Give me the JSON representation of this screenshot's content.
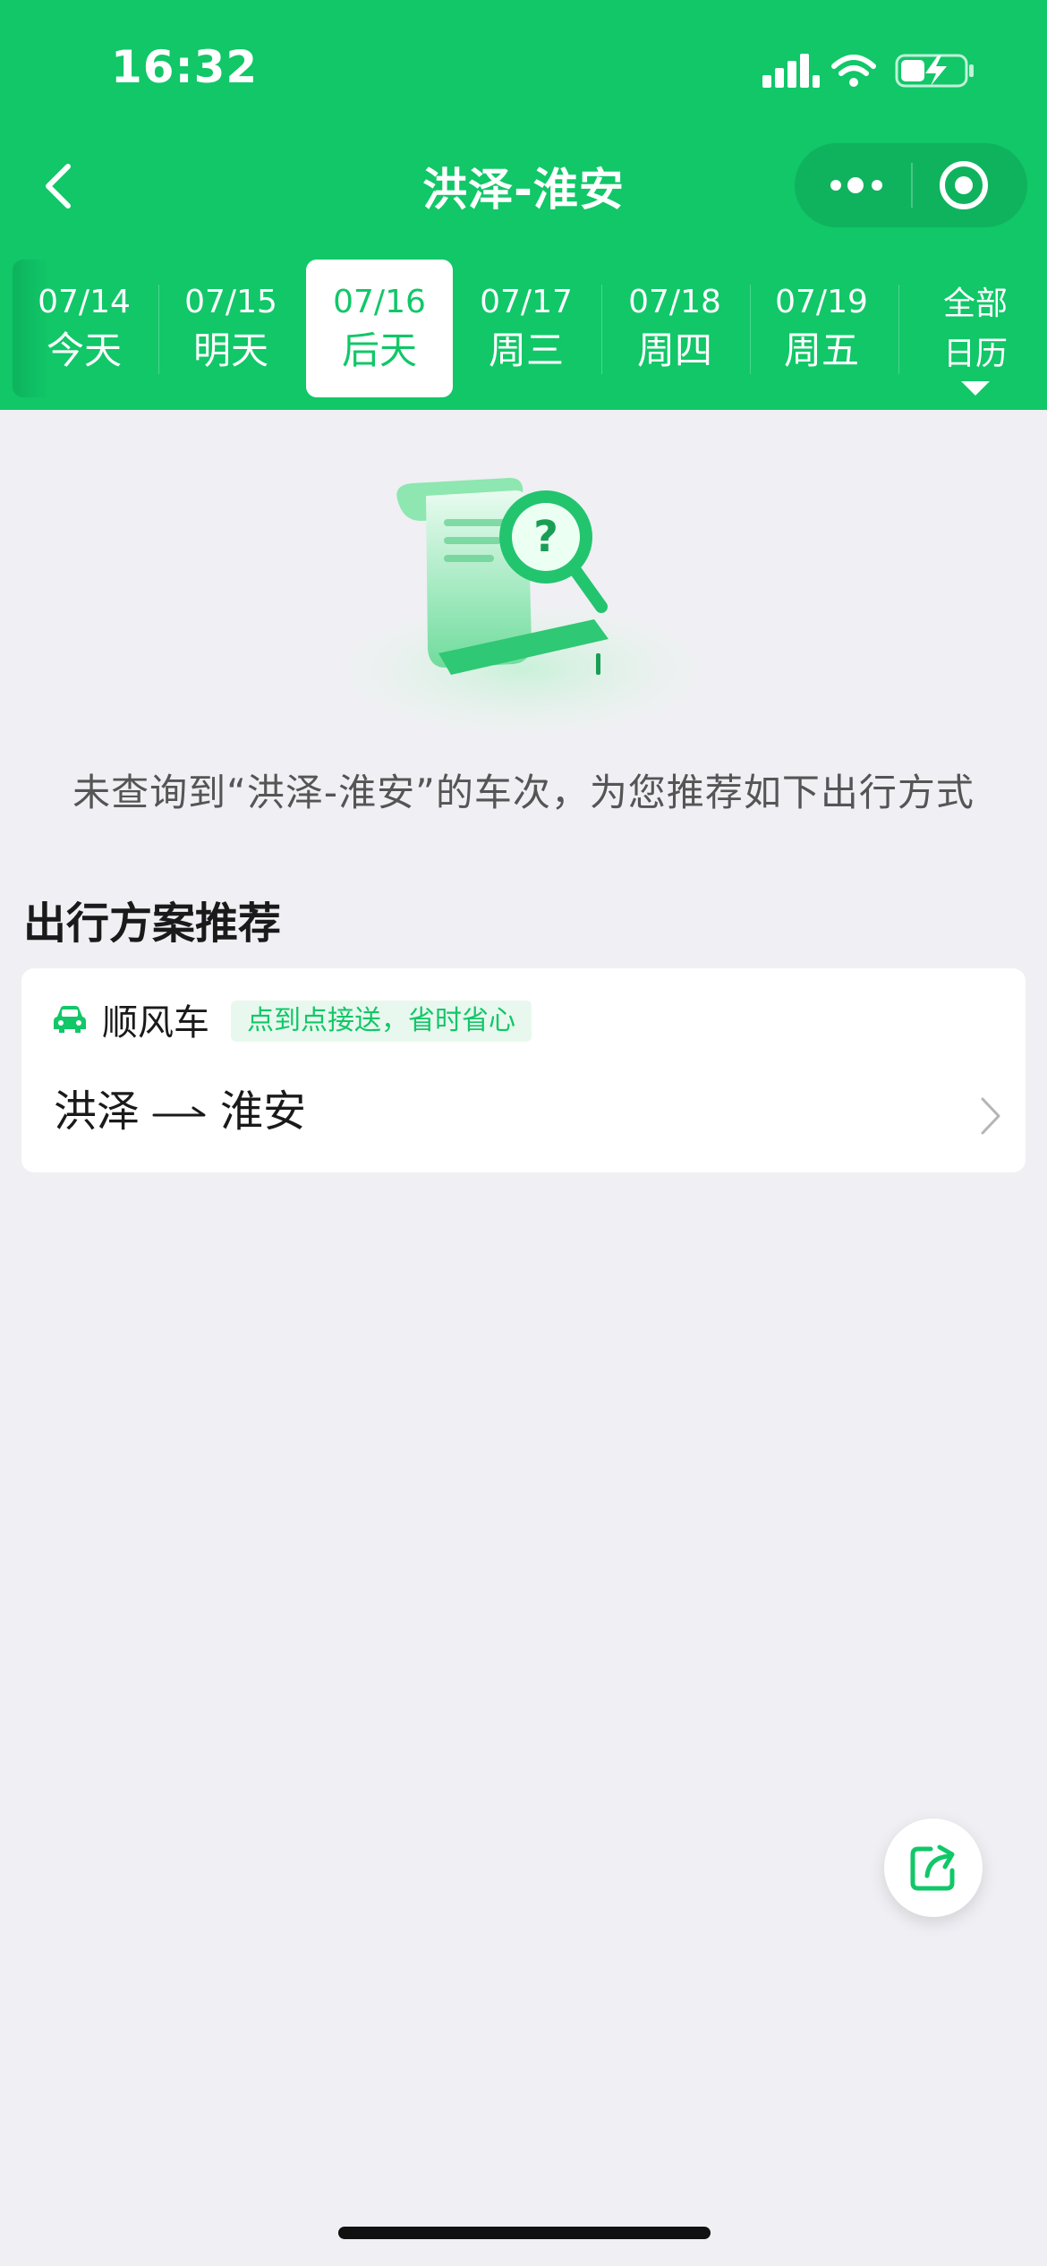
{
  "status_bar": {
    "time": "16:32"
  },
  "nav": {
    "title": "洪泽-淮安"
  },
  "dates": [
    {
      "date": "07/14",
      "day": "今天",
      "active": false
    },
    {
      "date": "07/15",
      "day": "明天",
      "active": false
    },
    {
      "date": "07/16",
      "day": "后天",
      "active": true
    },
    {
      "date": "07/17",
      "day": "周三",
      "active": false
    },
    {
      "date": "07/18",
      "day": "周四",
      "active": false
    },
    {
      "date": "07/19",
      "day": "周五",
      "active": false
    }
  ],
  "calendar": {
    "line1": "全部",
    "line2": "日历"
  },
  "empty_state": {
    "message": "未查询到“洪泽-淮安”的车次，为您推荐如下出行方式"
  },
  "recommend": {
    "section_title": "出行方案推荐",
    "card": {
      "type": "顺风车",
      "tag": "点到点接送，省时省心",
      "from": "洪泽",
      "to": "淮安"
    }
  },
  "colors": {
    "brand": "#11c768",
    "background": "#efeff4",
    "tag_bg": "#e8f8ee"
  },
  "icons": {
    "back": "chevron-left-icon",
    "more": "more-dots-icon",
    "close": "target-close-icon",
    "car": "car-icon",
    "share": "share-icon"
  }
}
